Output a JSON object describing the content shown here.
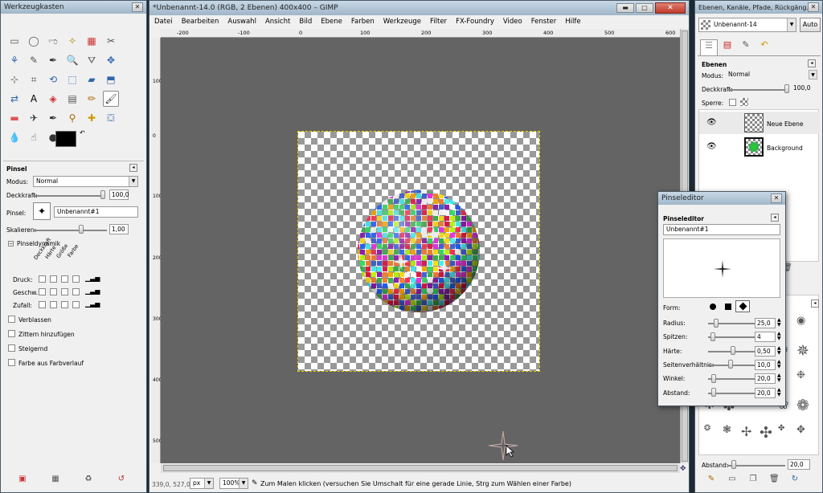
{
  "toolbox": {
    "title": "Werkzeugkasten",
    "section_title": "Pinsel",
    "mode_label": "Modus:",
    "mode_value": "Normal",
    "opacity_label": "Deckkraft:",
    "opacity_value": "100,0",
    "brush_label": "Pinsel:",
    "brush_value": "Unbenannt#1",
    "scale_label": "Skalieren:",
    "scale_value": "1,00",
    "dynamics_label": "Pinseldynamik",
    "dyn_cols": [
      "Deckkraft",
      "Härte",
      "Größe",
      "Farbe"
    ],
    "dyn_rows": [
      "Druck:",
      "Geschw.:",
      "Zufall:"
    ],
    "options": [
      "Verblassen",
      "Zittern hinzufügen",
      "Steigernd",
      "Farbe aus Farbverlauf"
    ]
  },
  "main": {
    "title": "*Unbenannt-14.0 (RGB, 2 Ebenen) 400x400 – GIMP",
    "menu": [
      "Datei",
      "Bearbeiten",
      "Auswahl",
      "Ansicht",
      "Bild",
      "Ebene",
      "Farben",
      "Werkzeuge",
      "Filter",
      "FX-Foundry",
      "Video",
      "Fenster",
      "Hilfe"
    ],
    "ruler_labels": [
      "-200",
      "-100",
      "0",
      "100",
      "200",
      "300",
      "400",
      "500",
      "600"
    ],
    "coords": "339,0, 527,0",
    "unit": "px",
    "zoom": "100%",
    "status": "Zum Malen klicken (versuchen Sie Umschalt für eine gerade Linie, Strg zum Wählen einer Farbe)"
  },
  "layers": {
    "title": "Ebenen, Kanäle, Pfade, Rückgäng...",
    "image_name": "Unbenannt-14",
    "auto_label": "Auto",
    "section_title": "Ebenen",
    "mode_label": "Modus:",
    "mode_value": "Normal",
    "opacity_label": "Deckkraft:",
    "opacity_value": "100,0",
    "lock_label": "Sperre:",
    "list": [
      {
        "name": "Neue Ebene"
      },
      {
        "name": "Background"
      }
    ]
  },
  "brushes": {
    "spacing_label": "Abstand:",
    "spacing_value": "20,0"
  },
  "brush_editor": {
    "title": "Pinseleditor",
    "section_title": "Pinseleditor",
    "name": "Unbenannt#1",
    "form_label": "Form:",
    "params": [
      {
        "label": "Radius:",
        "value": "25,0",
        "pos": 0.12
      },
      {
        "label": "Spitzen:",
        "value": "4",
        "pos": 0.05
      },
      {
        "label": "Härte:",
        "value": "0,50",
        "pos": 0.5
      },
      {
        "label": "Seitenverhältnis:",
        "value": "10,0",
        "pos": 0.45
      },
      {
        "label": "Winkel:",
        "value": "20,0",
        "pos": 0.08
      },
      {
        "label": "Abstand:",
        "value": "20,0",
        "pos": 0.08
      }
    ]
  }
}
